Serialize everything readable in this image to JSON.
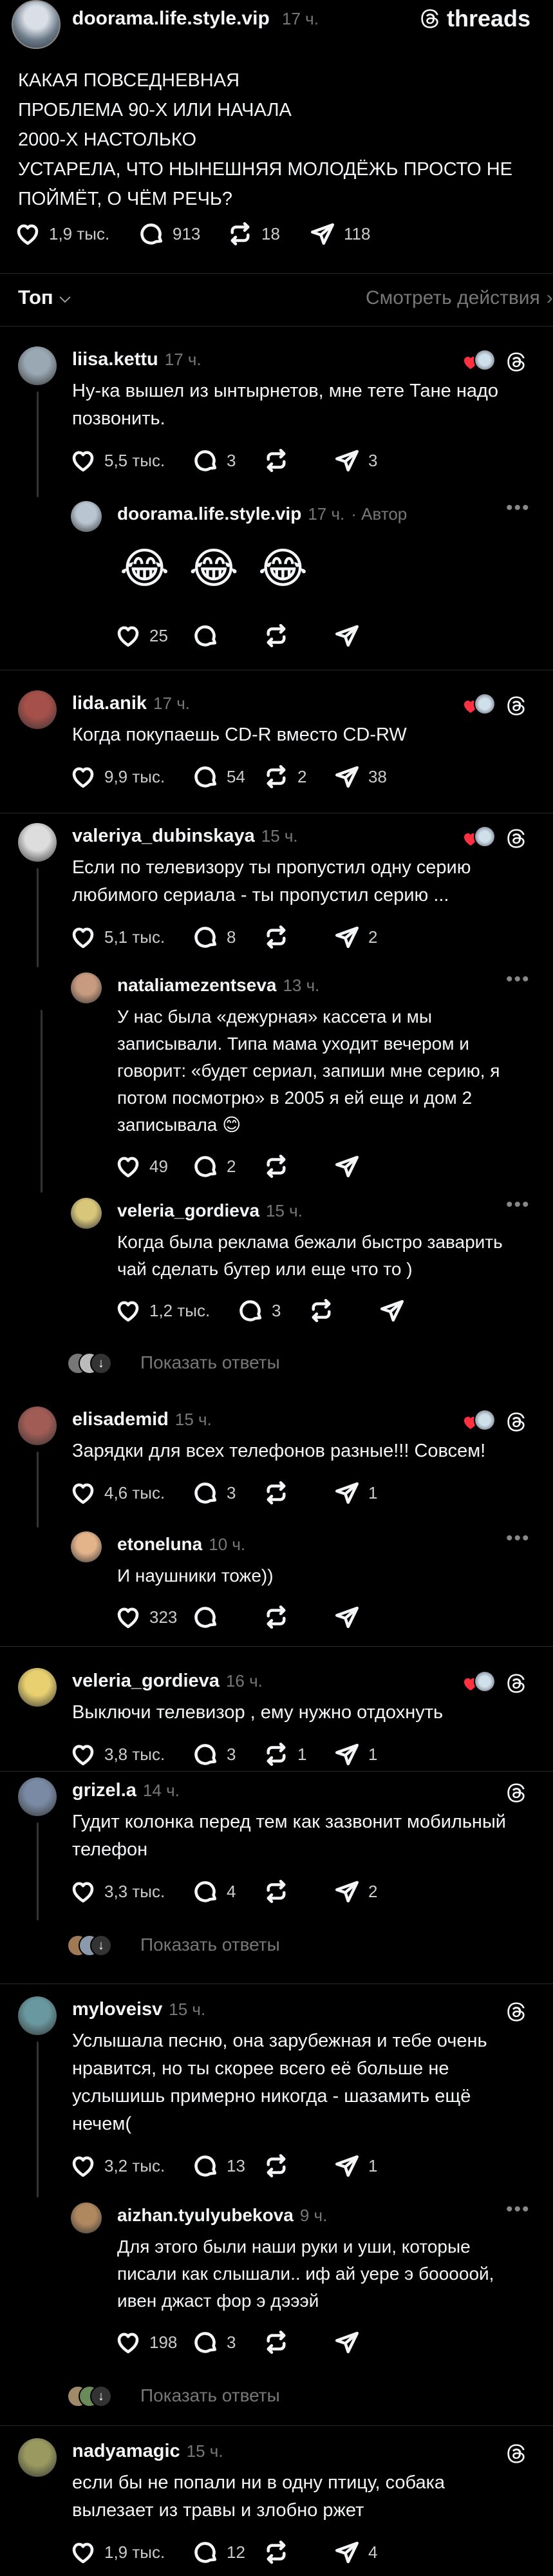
{
  "post": {
    "author": "doorama.life.style.vip",
    "time": "17 ч.",
    "brand": "threads",
    "lines": [
      "КАКАЯ ПОВСЕДНЕВНАЯ",
      "ПРОБЛЕМА 90-Х ИЛИ НАЧАЛА",
      "2000-Х НАСТОЛЬКО",
      "УСТАРЕЛА, ЧТО НЫНЕШНЯЯ МОЛОДЁЖЬ ПРОСТО НЕ",
      "ПОЙМЁТ, О ЧЁМ РЕЧЬ?"
    ],
    "likes": "1,9 тыс.",
    "comments": "913",
    "reposts": "18",
    "shares": "118"
  },
  "sort": {
    "label": "Топ",
    "actions": "Смотреть действия"
  },
  "show_replies": "Показать ответы",
  "author_badge": "Автор",
  "comments": [
    {
      "user": "liisa.kettu",
      "time": "17 ч.",
      "lines": [
        "Ну-ка вышел из ынтырнетов, мне тете Тане надо",
        "позвонить."
      ],
      "likes": "5,5 тыс.",
      "comments": "3",
      "reposts": "",
      "shares": "3"
    },
    {
      "user": "doorama.life.style.vip",
      "time": "17 ч.",
      "emoji": "😂 😂 😂",
      "likes": "25",
      "comments": "",
      "reposts": "",
      "shares": ""
    },
    {
      "user": "lida.anik",
      "time": "17 ч.",
      "lines": [
        "Когда  покупаешь CD-R вместо CD-RW"
      ],
      "likes": "9,9 тыс.",
      "comments": "54",
      "reposts": "2",
      "shares": "38"
    },
    {
      "user": "valeriya_dubinskaya",
      "time": "15 ч.",
      "lines": [
        "Если по телевизору ты пропустил одну серию",
        "любимого сериала - ты пропустил серию ..."
      ],
      "likes": "5,1 тыс.",
      "comments": "8",
      "reposts": "",
      "shares": "2"
    },
    {
      "user": "nataliamezentseva",
      "time": "13 ч.",
      "lines": [
        "У нас была «дежурная» кассета и мы",
        "записывали. Типа мама уходит вечером и",
        "говорит: «будет сериал, запиши мне серию, я",
        "потом посмотрю» в 2005 я ей еще и дом 2",
        "записывала 😊"
      ],
      "likes": "49",
      "comments": "2",
      "reposts": "",
      "shares": ""
    },
    {
      "user": "veleria_gordieva",
      "time": "15 ч.",
      "lines": [
        "Когда была реклама бежали быстро заварить",
        "чай сделать бутер или еще что то )"
      ],
      "likes": "1,2 тыс.",
      "comments": "3",
      "reposts": "",
      "shares": ""
    },
    {
      "user": "elisademid",
      "time": "15 ч.",
      "lines": [
        "Зарядки для всех телефонов разные!!! Совсем!"
      ],
      "likes": "4,6 тыс.",
      "comments": "3",
      "reposts": "",
      "shares": "1"
    },
    {
      "user": "etoneluna",
      "time": "10 ч.",
      "lines": [
        "И наушники тоже))"
      ],
      "likes": "323",
      "comments": "",
      "reposts": "",
      "shares": ""
    },
    {
      "user": "veleria_gordieva",
      "time": "16 ч.",
      "lines": [
        "Выключи  телевизор , ему нужно отдохнуть"
      ],
      "likes": "3,8 тыс.",
      "comments": "3",
      "reposts": "1",
      "shares": "1"
    },
    {
      "user": "grizel.a",
      "time": "14 ч.",
      "lines": [
        "Гудит колонка перед тем как зазвонит мобильный",
        "телефон"
      ],
      "likes": "3,3 тыс.",
      "comments": "4",
      "reposts": "",
      "shares": "2"
    },
    {
      "user": "myloveisv",
      "time": "15 ч.",
      "lines": [
        "Услышала песню, она зарубежная и тебе очень",
        "нравится, но ты скорее всего её больше не",
        "услышишь примерно никогда - шазамить ещё",
        "нечем("
      ],
      "likes": "3,2 тыс.",
      "comments": "13",
      "reposts": "",
      "shares": "1"
    },
    {
      "user": "aizhan.tyulyubekova",
      "time": "9 ч.",
      "lines": [
        "Для этого были наши руки и уши, которые",
        "писали как слышали.. иф ай уере э бооооой,",
        "ивен джаст фор э дэээй"
      ],
      "likes": "198",
      "comments": "3",
      "reposts": "",
      "shares": ""
    },
    {
      "user": "nadyamagic",
      "time": "15 ч.",
      "lines": [
        "если бы не попали ни в одну птицу, собака",
        "вылезает из травы и злобно ржет"
      ],
      "likes": "1,9 тыс.",
      "comments": "12",
      "reposts": "",
      "shares": "4"
    }
  ]
}
